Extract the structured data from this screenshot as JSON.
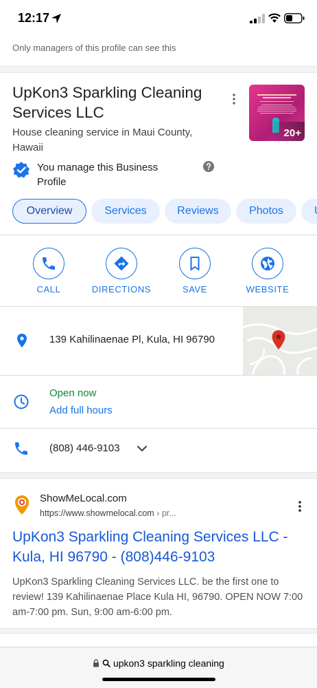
{
  "status": {
    "time": "12:17"
  },
  "notice": "Only managers of this profile can see this",
  "business": {
    "name": "UpKon3 Sparkling Cleaning Services LLC",
    "category": "House cleaning service in Maui County, Hawaii",
    "photo_count": "20+",
    "manage_text": "You manage this Business Profile"
  },
  "tabs": [
    {
      "label": "Overview",
      "active": true
    },
    {
      "label": "Services"
    },
    {
      "label": "Reviews"
    },
    {
      "label": "Photos"
    },
    {
      "label": "U"
    }
  ],
  "actions": [
    {
      "label": "CALL",
      "icon": "phone-icon"
    },
    {
      "label": "DIRECTIONS",
      "icon": "directions-icon"
    },
    {
      "label": "SAVE",
      "icon": "bookmark-icon"
    },
    {
      "label": "WEBSITE",
      "icon": "globe-icon"
    }
  ],
  "info": {
    "address": "139 Kahilinaenae Pl, Kula, HI 96790",
    "open_status": "Open now",
    "add_hours": "Add full hours",
    "phone": "(808) 446-9103"
  },
  "result": {
    "site_name": "ShowMeLocal.com",
    "url": "https://www.showmelocal.com",
    "url_crumb": " › pr...",
    "title": "UpKon3 Sparkling Cleaning Services LLC - Kula, HI 96790 - (808)446-9103",
    "snippet": "UpKon3 Sparkling Cleaning Services LLC. be the first one to review! 139 Kahilinaenae Place Kula HI, 96790. OPEN NOW 7:00 am-7:00 pm. Sun, 9:00 am-6:00 pm."
  },
  "browser": {
    "url_text": "upkon3 sparkling cleaning"
  },
  "colors": {
    "accent": "#1a73e8",
    "open": "#188038",
    "link": "#1558d6",
    "pin": "#d93025"
  }
}
